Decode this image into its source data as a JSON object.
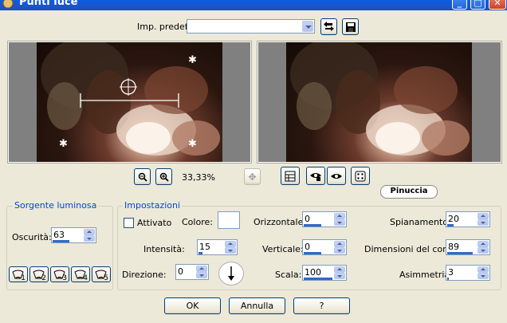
{
  "window": {
    "title": "Punti luce"
  },
  "preset": {
    "label": "Imp. predef.:",
    "value": ""
  },
  "zoom": {
    "value": "33,33%"
  },
  "watermark": "Pinuccia",
  "light_source": {
    "group_title": "Sorgente luminosa",
    "darkness_label": "Oscurità:",
    "darkness_value": "63",
    "buttons": [
      "1",
      "2",
      "3",
      "4",
      "5"
    ]
  },
  "settings": {
    "group_title": "Impostazioni",
    "enabled_label": "Attivato",
    "enabled_checked": false,
    "color_label": "Colore:",
    "color_value": "#ffffff",
    "intensity_label": "Intensità:",
    "intensity_value": "15",
    "direction_label": "Direzione:",
    "direction_value": "0",
    "horizontal_label": "Orizzontale:",
    "horizontal_value": "0",
    "vertical_label": "Verticale:",
    "vertical_value": "0",
    "scale_label": "Scala:",
    "scale_value": "100",
    "smoothing_label": "Spianamento:",
    "smoothing_value": "20",
    "cone_label": "Dimensioni del cono:",
    "cone_value": "89",
    "asymmetry_label": "Asimmetria:",
    "asymmetry_value": "3"
  },
  "buttons": {
    "ok": "OK",
    "cancel": "Annulla",
    "help": "?"
  }
}
